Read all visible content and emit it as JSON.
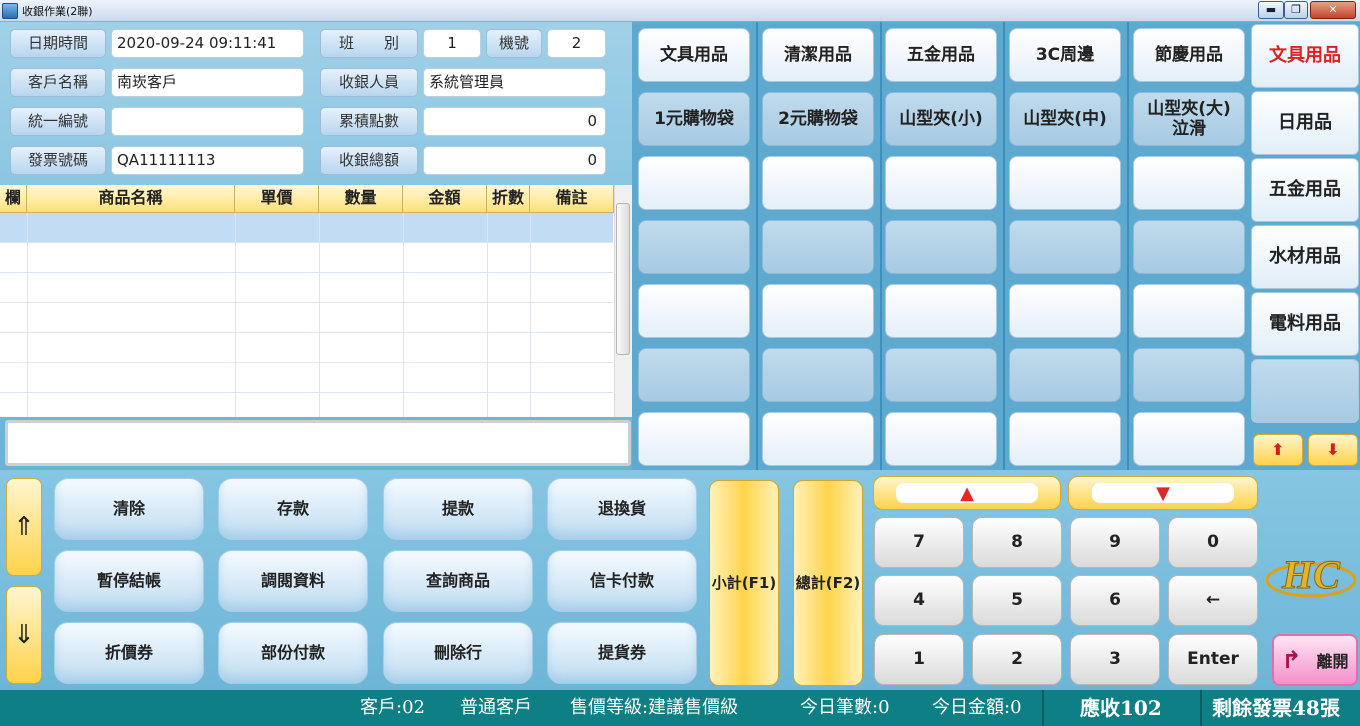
{
  "window": {
    "title": "收銀作業(2聯)",
    "min_label": "▬",
    "max_label": "❐",
    "close_label": "✕"
  },
  "header": {
    "datetime_label": "日期時間",
    "datetime_value": "2020-09-24 09:11:41",
    "shift_label": "班　　別",
    "shift_value": "1",
    "machine_label": "機號",
    "machine_value": "2",
    "customer_label": "客戶名稱",
    "customer_value": "南崁客戶",
    "cashier_label": "收銀人員",
    "cashier_value": "系統管理員",
    "taxid_label": "統一編號",
    "taxid_value": "",
    "points_label": "累積點數",
    "points_value": "0",
    "invoice_label": "發票號碼",
    "invoice_value": "QA11111113",
    "total_label": "收銀總額",
    "total_value": "0"
  },
  "table": {
    "columns": [
      "欄",
      "商品名稱",
      "單價",
      "數量",
      "金額",
      "折數",
      "備註"
    ],
    "rows": []
  },
  "products": {
    "row1": [
      "文具用品",
      "清潔用品",
      "五金用品",
      "3C周邊",
      "節慶用品"
    ],
    "row2": [
      "1元購物袋",
      "2元購物袋",
      "山型夾(小)",
      "山型夾(中)",
      "山型夾(大)\n泣滑"
    ]
  },
  "categories": [
    "文具用品",
    "日用品",
    "五金用品",
    "水材用品",
    "電料用品",
    ""
  ],
  "cat_nav": {
    "up": "⬆",
    "down": "⬇"
  },
  "functions": [
    [
      "清除",
      "存款",
      "提款",
      "退換貨"
    ],
    [
      "暫停結帳",
      "調閱資料",
      "查詢商品",
      "信卡付款"
    ],
    [
      "折價券",
      "部份付款",
      "刪除行",
      "提貨券"
    ]
  ],
  "subtotal": {
    "sub_label": "小計(F1)",
    "total_label": "總計(F2)"
  },
  "side_arrows": {
    "up": "⇑",
    "down": "⇓"
  },
  "keypad": {
    "keys": [
      [
        "7",
        "8",
        "9",
        "0"
      ],
      [
        "4",
        "5",
        "6",
        "←"
      ],
      [
        "1",
        "2",
        "3",
        "Enter"
      ]
    ],
    "page_up": "▲",
    "page_down": "▼"
  },
  "logo": {
    "text": "HC"
  },
  "exit": {
    "label": "離開",
    "icon": "↱"
  },
  "status": {
    "customer_code": "客戶:02",
    "customer_type": "普通客戶",
    "price_level": "售價等級:建議售價級",
    "today_count": "今日筆數:0",
    "today_amount": "今日金額:0",
    "receivable": "應收102",
    "remaining_invoice": "剩餘發票48張"
  },
  "colors": {
    "accent_yellow": "#ffd24a",
    "panel_blue": "#5ea9cf",
    "status_teal": "#0f7f86",
    "active_category": "#e02020"
  }
}
